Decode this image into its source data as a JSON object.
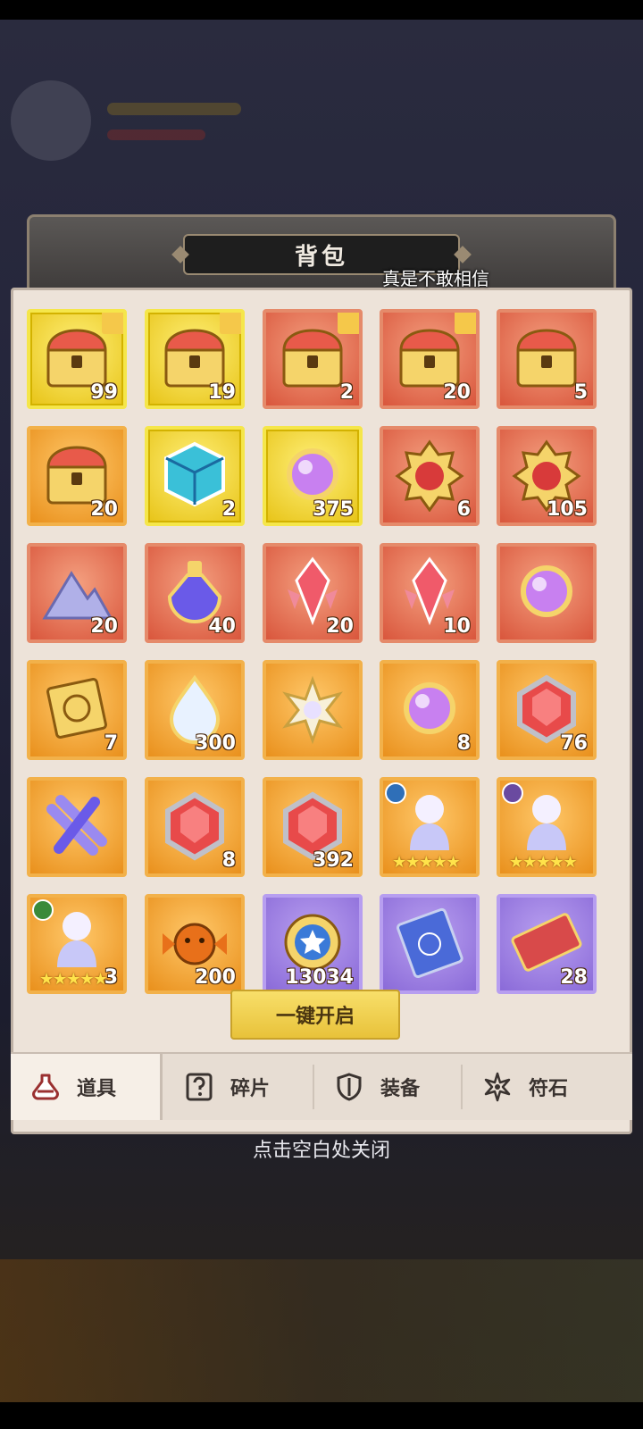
{
  "panel": {
    "title": "背包",
    "danmaku": "真是不敢相信"
  },
  "items": [
    {
      "color": "gold",
      "count": "99",
      "icon": "chest-icon",
      "badge": true
    },
    {
      "color": "gold",
      "count": "19",
      "icon": "chest-icon",
      "badge": true
    },
    {
      "color": "red",
      "count": "2",
      "icon": "chest-icon",
      "badge": true
    },
    {
      "color": "red",
      "count": "20",
      "icon": "chest-icon",
      "badge": true
    },
    {
      "color": "red",
      "count": "5",
      "icon": "chest-icon",
      "badge": false
    },
    {
      "color": "orange",
      "count": "20",
      "icon": "chest-icon",
      "badge": false
    },
    {
      "color": "gold",
      "count": "2",
      "icon": "cube-icon",
      "badge": false
    },
    {
      "color": "gold",
      "count": "375",
      "icon": "orb-icon",
      "badge": false
    },
    {
      "color": "red",
      "count": "6",
      "icon": "emblem-icon",
      "badge": false
    },
    {
      "color": "red",
      "count": "105",
      "icon": "emblem-icon",
      "badge": false
    },
    {
      "color": "red",
      "count": "20",
      "icon": "dust-icon",
      "badge": false
    },
    {
      "color": "red",
      "count": "40",
      "icon": "potion-icon",
      "badge": false
    },
    {
      "color": "red",
      "count": "20",
      "icon": "crystal-icon",
      "badge": false
    },
    {
      "color": "red",
      "count": "10",
      "icon": "crystal-icon",
      "badge": false
    },
    {
      "color": "red",
      "count": "",
      "icon": "orb-icon",
      "badge": false
    },
    {
      "color": "orange",
      "count": "7",
      "icon": "scroll-icon",
      "badge": false
    },
    {
      "color": "orange",
      "count": "300",
      "icon": "drop-icon",
      "badge": false
    },
    {
      "color": "orange",
      "count": "",
      "icon": "flower-icon",
      "badge": false
    },
    {
      "color": "orange",
      "count": "8",
      "icon": "orb-icon",
      "badge": false
    },
    {
      "color": "orange",
      "count": "76",
      "icon": "gem-icon",
      "badge": false
    },
    {
      "color": "orange",
      "count": "",
      "icon": "cross-icon",
      "badge": false
    },
    {
      "color": "orange",
      "count": "8",
      "icon": "gem-icon",
      "badge": false
    },
    {
      "color": "orange",
      "count": "392",
      "icon": "gem-icon",
      "badge": false
    },
    {
      "color": "orange",
      "count": "",
      "icon": "hero-icon",
      "badge": false,
      "stars": "★★★★★",
      "faction": "#2f6fb8"
    },
    {
      "color": "orange",
      "count": "",
      "icon": "hero-icon",
      "badge": false,
      "stars": "★★★★★",
      "faction": "#6a4aa0"
    },
    {
      "color": "orange",
      "count": "3",
      "icon": "hero-icon",
      "badge": false,
      "stars": "★★★★★",
      "faction": "#3a8a3a"
    },
    {
      "color": "orange",
      "count": "200",
      "icon": "candy-icon",
      "badge": false
    },
    {
      "color": "purple",
      "count": "13034",
      "icon": "coin-icon",
      "badge": false
    },
    {
      "color": "purple",
      "count": "",
      "icon": "book-icon",
      "badge": false
    },
    {
      "color": "purple",
      "count": "28",
      "icon": "ticket-icon",
      "badge": false
    }
  ],
  "actions": {
    "open_all": "一键开启"
  },
  "tabs": [
    {
      "label": "道具",
      "icon": "potion-tab-icon"
    },
    {
      "label": "碎片",
      "icon": "question-tab-icon"
    },
    {
      "label": "装备",
      "icon": "shield-tab-icon"
    },
    {
      "label": "符石",
      "icon": "star-tab-icon"
    }
  ],
  "hint": "点击空白处关闭"
}
